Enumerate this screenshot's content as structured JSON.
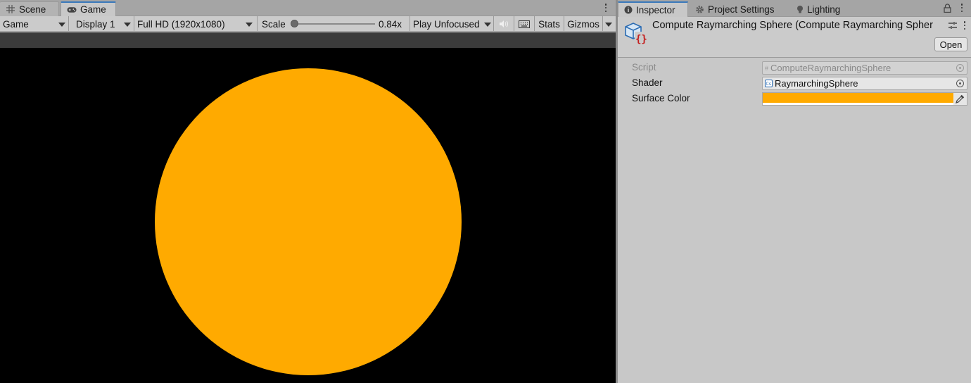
{
  "game_pane": {
    "tabs": [
      {
        "label": "Scene",
        "icon": "grid-icon"
      },
      {
        "label": "Game",
        "icon": "gamepad-icon"
      }
    ],
    "toolbar": {
      "view": "Game",
      "display": "Display 1",
      "resolution": "Full HD (1920x1080)",
      "scale_label": "Scale",
      "scale_value": "0.84x",
      "play_mode": "Play Unfocused",
      "stats": "Stats",
      "gizmos": "Gizmos"
    },
    "render": {
      "background": "#000000",
      "sphere_color": "#FFAA00"
    }
  },
  "inspector_pane": {
    "tabs": [
      {
        "label": "Inspector",
        "icon": "info-icon"
      },
      {
        "label": "Project Settings",
        "icon": "gear-icon"
      },
      {
        "label": "Lighting",
        "icon": "bulb-icon"
      }
    ],
    "header": {
      "title": "Compute Raymarching Sphere (Compute Raymarching Spher",
      "open_label": "Open"
    },
    "properties": [
      {
        "label": "Script",
        "value": "ComputeRaymarchingSphere",
        "icon": "script-icon"
      },
      {
        "label": "Shader",
        "value": "RaymarchingSphere",
        "icon": "cs-icon"
      },
      {
        "label": "Surface Color",
        "color": "#FFAA00"
      }
    ]
  },
  "colors": {
    "accent": "#3A79BB",
    "surface": "#FFAA00"
  }
}
